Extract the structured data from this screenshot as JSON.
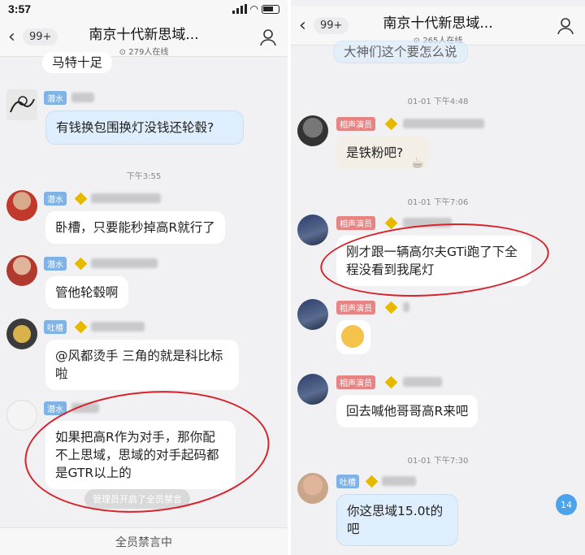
{
  "left": {
    "status": {
      "time": "3:57"
    },
    "header": {
      "back_badge": "99+",
      "title": "南京十代新思域...",
      "online": "279人在线"
    },
    "top_fragment": "马特十足",
    "messages": [
      {
        "tag": "潜水",
        "text": "有钱换包围换灯没钱还轮毂?"
      },
      {
        "timestamp": "下午3:55"
      },
      {
        "tag": "潜水",
        "text": "卧槽，只要能秒掉高R就行了"
      },
      {
        "tag": "潜水",
        "text": "管他轮毂啊"
      },
      {
        "tag": "吐槽",
        "text": "@风都烫手 三角的就是科比标啦"
      },
      {
        "tag": "潜水",
        "text": "如果把高R作为对手，那你配不上思域，思域的对手起码都是GTR以上的"
      }
    ],
    "notice": "管理员开启了全员禁言",
    "bottom": "全员禁言中"
  },
  "right": {
    "header": {
      "back_badge": "99+",
      "title": "南京十代新思域...",
      "online": "265人在线"
    },
    "top_fragment": "大神们这个要怎么说",
    "messages": [
      {
        "timestamp": "01-01 下午4:48"
      },
      {
        "tag": "相声演员",
        "text": "是铁粉吧?"
      },
      {
        "timestamp": "01-01 下午7:06"
      },
      {
        "tag": "相声演员",
        "text": "刚才跟一辆高尔夫GTi跑了下全程没看到我尾灯"
      },
      {
        "tag": "相声演员",
        "text": ""
      },
      {
        "tag": "相声演员",
        "text": "回去喊他哥哥高R来吧"
      },
      {
        "timestamp": "01-01 下午7:30"
      },
      {
        "tag": "吐槽",
        "text": "你这思域15.0t的吧"
      }
    ],
    "unread_count": "14"
  },
  "colors": {
    "highlight_circle": "#d6232b",
    "tag_blue": "#7fb2e5",
    "tag_red": "#e68383"
  }
}
